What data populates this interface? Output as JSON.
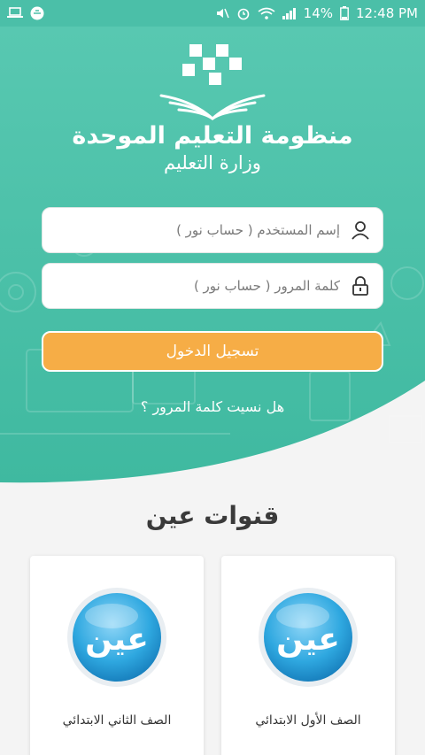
{
  "status_bar": {
    "battery": "14%",
    "time": "12:48 PM"
  },
  "app": {
    "title": "منظومة التعليم الموحدة",
    "subtitle": "وزارة التعليم"
  },
  "login": {
    "username_placeholder": "إسم المستخدم ( حساب نور )",
    "password_placeholder": "كلمة المرور ( حساب نور )",
    "login_button": "تسجيل الدخول",
    "forgot_password": "هل نسيت كلمة المرور ؟"
  },
  "channels": {
    "title": "قنوات عين",
    "logo_text": "عين",
    "items": [
      {
        "label": "الصف الأول الابتدائي"
      },
      {
        "label": "الصف الثاني الابتدائي"
      }
    ]
  },
  "colors": {
    "primary": "#4bbfa8",
    "accent": "#f6ad46",
    "channel_blue": "#2fa8e0"
  }
}
